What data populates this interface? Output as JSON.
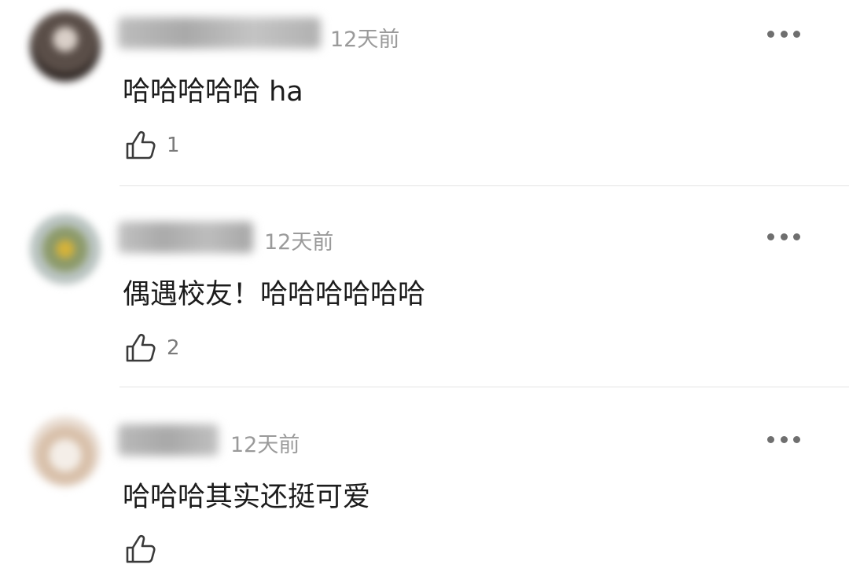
{
  "comments": [
    {
      "name": "苏米德理想计划",
      "time": "12天前",
      "text": "哈哈哈哈哈 ha",
      "likes": "1"
    },
    {
      "name": "Bell Ring",
      "time": "12天前",
      "text": "偶遇校友！哈哈哈哈哈哈",
      "likes": "2"
    },
    {
      "name": "橘鱼丸",
      "time": "12天前",
      "text": "哈哈哈其实还挺可爱",
      "likes": ""
    }
  ],
  "icons": {
    "like": "thumbs-up-icon",
    "more": "more-dots-icon"
  },
  "colors": {
    "text": "#1c1c1c",
    "meta": "#9a9a9a",
    "divider": "#e4e4e4"
  }
}
